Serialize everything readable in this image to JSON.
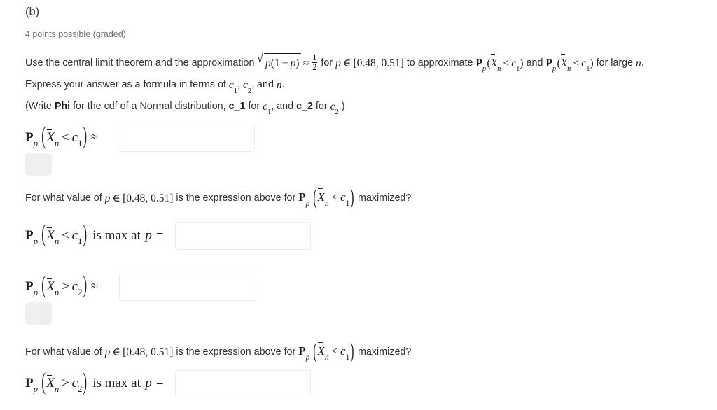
{
  "problem": {
    "part_label": "(b)",
    "points_text": "4 points possible (graded)"
  },
  "prompt": {
    "lead_1": "Use the central limit theorem and the approximation",
    "sqrt_radicand": {
      "p": "p",
      "open": "(",
      "one": "1",
      "minus": "−",
      "p2": "p",
      "close": ")"
    },
    "approx_sign": "≈",
    "half_num": "1",
    "half_den": "2",
    "lead_2": "for",
    "var_p": "p",
    "in_sign": "∈",
    "interval": "[0.48, 0.51]",
    "lead_3": "to approximate",
    "lead_4": "and",
    "lead_5": "for large",
    "var_n": "n",
    "lead_6": ". Express your answer as a formula in terms of",
    "c1_text": "c",
    "c1_sub": "1",
    "comma": ",",
    "c2_text": "c",
    "c2_sub": "2",
    "lead_7": ", and",
    "period": "."
  },
  "note": {
    "open": "(Write",
    "phi_bold": "Phi",
    "mid_1": "for the cdf of a Normal distribution,",
    "c1_bold": "c_1",
    "mid_2": "for",
    "mid_3": ", and",
    "c2_bold": "c_2",
    "mid_4": "for",
    "close": ".)"
  },
  "math_tokens": {
    "P": "P",
    "p_sub": "p",
    "paren_open": "(",
    "paren_close": ")",
    "X": "X",
    "n_sub": "n",
    "less_than": "<",
    "greater_than": ">",
    "c": "c",
    "one": "1",
    "two": "2",
    "approx": "≈",
    "equals": "="
  },
  "questions": {
    "q1_lead": "For what value of",
    "q1_var": "p",
    "q1_in": "∈",
    "q1_interval": "[0.48, 0.51]",
    "q1_mid": "is the expression above for",
    "q1_tail": "maximized?",
    "q2_lead": "For what value of",
    "q2_var": "p",
    "q2_in": "∈",
    "q2_interval": "[0.48, 0.51]",
    "q2_mid": "is the expression above for",
    "q2_tail": "maximized?"
  },
  "rows": {
    "row1": {
      "label_tail": "≈",
      "input_value": "",
      "input_placeholder": ""
    },
    "row2": {
      "label_tail": "is max at",
      "label_eq": "p =",
      "input_value": "",
      "input_placeholder": ""
    },
    "row3": {
      "label_tail": "≈",
      "input_value": "",
      "input_placeholder": ""
    },
    "row4": {
      "label_tail": "is max at",
      "label_eq": "p =",
      "input_value": "",
      "input_placeholder": ""
    }
  },
  "colors": {
    "text": "#2d3034",
    "muted": "#6b6f73",
    "math": "#1b1c1d",
    "input_border": "#eaecee",
    "chip_bg": "#efefef",
    "page_bg": "#ffffff"
  }
}
